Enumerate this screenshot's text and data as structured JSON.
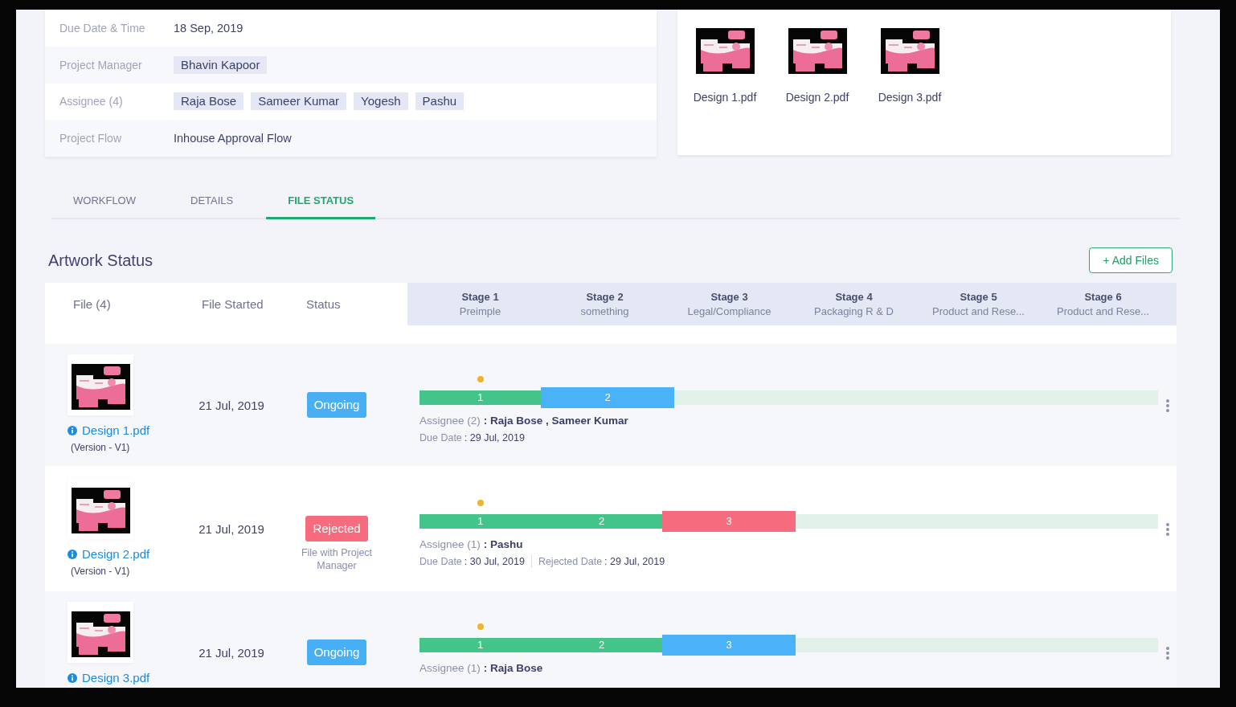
{
  "project_details": {
    "rows": [
      {
        "label": "Due Date & Time",
        "kind": "text",
        "value": "18 Sep, 2019"
      },
      {
        "label": "Project Manager",
        "kind": "tags",
        "tags": [
          "Bhavin Kapoor"
        ]
      },
      {
        "label": "Assignee (4)",
        "kind": "tags",
        "tags": [
          "Raja Bose",
          "Sameer Kumar",
          "Yogesh",
          "Pashu"
        ]
      },
      {
        "label": "Project Flow",
        "kind": "text",
        "value": "Inhouse Approval Flow"
      }
    ]
  },
  "attached_files": [
    {
      "name": "Design 1.pdf"
    },
    {
      "name": "Design 2.pdf"
    },
    {
      "name": "Design 3.pdf"
    }
  ],
  "tabs": [
    {
      "label": "WORKFLOW",
      "selected": false
    },
    {
      "label": "DETAILS",
      "selected": false
    },
    {
      "label": "FILE STATUS",
      "selected": true
    }
  ],
  "artwork_status": {
    "title": "Artwork Status",
    "add_button": "+ Add Files",
    "columns": [
      "File (4)",
      "File Started",
      "Status"
    ],
    "stages": [
      {
        "name": "Stage 1",
        "subtitle": "Preimple"
      },
      {
        "name": "Stage 2",
        "subtitle": "something"
      },
      {
        "name": "Stage 3",
        "subtitle": "Legal/Compliance"
      },
      {
        "name": "Stage 4",
        "subtitle": "Packaging R & D"
      },
      {
        "name": "Stage 5",
        "subtitle": "Product and Rese..."
      },
      {
        "name": "Stage 6",
        "subtitle": "Product and Rese..."
      }
    ],
    "rows": [
      {
        "file": "Design 1.pdf",
        "version": "(Version - V1)",
        "started": "21 Jul, 2019",
        "status": {
          "label": "Ongoing",
          "kind": "ongoing"
        },
        "progress": [
          {
            "label": "1",
            "kind": "done"
          },
          {
            "label": "2",
            "kind": "current"
          }
        ],
        "assignee": {
          "label": "Assignee (2)",
          "value": ": Raja Bose , Sameer Kumar"
        },
        "dates": [
          {
            "label": "Due Date",
            "value": ": 29 Jul, 2019"
          }
        ]
      },
      {
        "file": "Design 2.pdf",
        "version": "(Version - V1)",
        "started": "21 Jul, 2019",
        "status": {
          "label": "Rejected",
          "kind": "rejected",
          "note": "File with Project Manager"
        },
        "progress": [
          {
            "label": "1",
            "kind": "done"
          },
          {
            "label": "2",
            "kind": "done"
          },
          {
            "label": "3",
            "kind": "rejected"
          }
        ],
        "assignee": {
          "label": "Assignee (1)",
          "value": ": Pashu"
        },
        "dates": [
          {
            "label": "Due Date",
            "value": ": 30 Jul, 2019"
          },
          {
            "label": "Rejected Date",
            "value": ": 29 Jul, 2019"
          }
        ]
      },
      {
        "file": "Design 3.pdf",
        "started": "21 Jul, 2019",
        "status": {
          "label": "Ongoing",
          "kind": "ongoing"
        },
        "progress": [
          {
            "label": "1",
            "kind": "done"
          },
          {
            "label": "2",
            "kind": "done"
          },
          {
            "label": "3",
            "kind": "current"
          }
        ],
        "assignee": {
          "label": "Assignee (1)",
          "value": ": Raja Bose"
        }
      }
    ]
  }
}
